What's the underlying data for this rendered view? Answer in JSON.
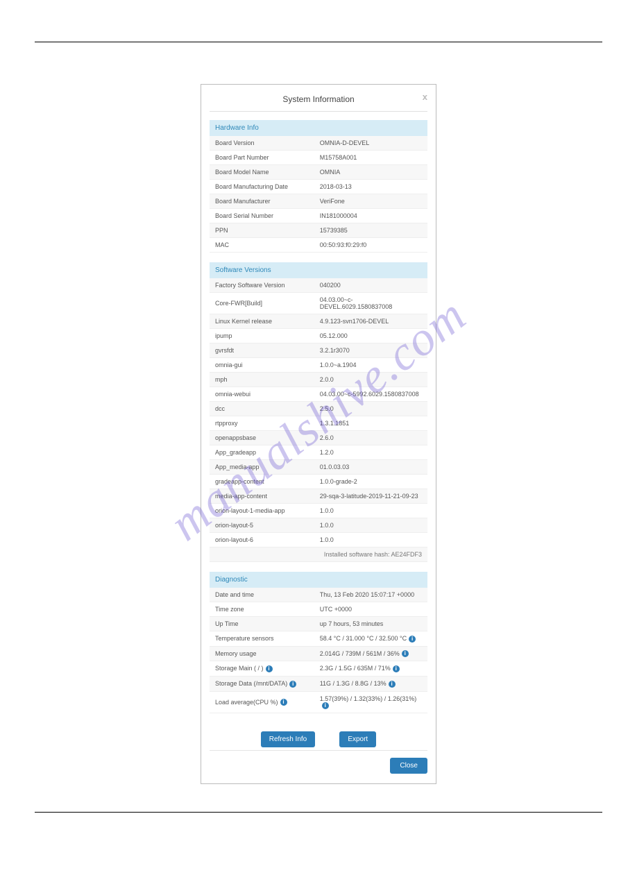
{
  "watermark": "manualshive.com",
  "dialog": {
    "title": "System Information",
    "close_x": "x"
  },
  "hardware": {
    "header": "Hardware Info",
    "rows": [
      {
        "label": "Board Version",
        "value": "OMNIA-D-DEVEL"
      },
      {
        "label": "Board Part Number",
        "value": "M15758A001"
      },
      {
        "label": "Board Model Name",
        "value": "OMNIA"
      },
      {
        "label": "Board Manufacturing Date",
        "value": "2018-03-13"
      },
      {
        "label": "Board Manufacturer",
        "value": "VeriFone"
      },
      {
        "label": "Board Serial Number",
        "value": "IN181000004"
      },
      {
        "label": "PPN",
        "value": "15739385"
      },
      {
        "label": "MAC",
        "value": "00:50:93:f0:29:f0"
      }
    ]
  },
  "software": {
    "header": "Software Versions",
    "rows": [
      {
        "label": "Factory Software Version",
        "value": "040200"
      },
      {
        "label": "Core-FWR[Build]",
        "value": "04.03.00~c-DEVEL.6029.1580837008"
      },
      {
        "label": "Linux Kernel release",
        "value": "4.9.123-svn1706-DEVEL"
      },
      {
        "label": "ipump",
        "value": "05.12.000"
      },
      {
        "label": "gvrsfdt",
        "value": "3.2.1r3070"
      },
      {
        "label": "omnia-gui",
        "value": "1.0.0~a.1904"
      },
      {
        "label": "mph",
        "value": "2.0.0"
      },
      {
        "label": "omnia-webui",
        "value": "04.03.00~c-5992.6029.1580837008"
      },
      {
        "label": "dcc",
        "value": "2.5.0"
      },
      {
        "label": "rtpproxy",
        "value": "1.3.1.1851"
      },
      {
        "label": "openappsbase",
        "value": "2.6.0"
      },
      {
        "label": "App_gradeapp",
        "value": "1.2.0"
      },
      {
        "label": "App_media-app",
        "value": "01.0.03.03"
      },
      {
        "label": "gradeapp-content",
        "value": "1.0.0-grade-2"
      },
      {
        "label": "media-app-content",
        "value": "29-sqa-3-latitude-2019-11-21-09-23"
      },
      {
        "label": "orion-layout-1-media-app",
        "value": "1.0.0"
      },
      {
        "label": "orion-layout-5",
        "value": "1.0.0"
      },
      {
        "label": "orion-layout-6",
        "value": "1.0.0"
      }
    ],
    "hash": "Installed software hash: AE24FDF3"
  },
  "diagnostic": {
    "header": "Diagnostic",
    "rows": [
      {
        "label": "Date and time",
        "value": "Thu, 13 Feb 2020 15:07:17 +0000",
        "info_label": false,
        "info_value": false
      },
      {
        "label": "Time zone",
        "value": "UTC +0000",
        "info_label": false,
        "info_value": false
      },
      {
        "label": "Up Time",
        "value": "up 7 hours, 53 minutes",
        "info_label": false,
        "info_value": false
      },
      {
        "label": "Temperature sensors",
        "value": "58.4 °C / 31.000 °C / 32.500 °C",
        "info_label": false,
        "info_value": true
      },
      {
        "label": "Memory usage",
        "value": "2.014G / 739M / 561M / 36%",
        "info_label": false,
        "info_value": true
      },
      {
        "label": "Storage Main ( / )",
        "value": "2.3G / 1.5G / 635M / 71%",
        "info_label": true,
        "info_value": true
      },
      {
        "label": "Storage Data (/mnt/DATA)",
        "value": "11G / 1.3G / 8.8G / 13%",
        "info_label": true,
        "info_value": true
      },
      {
        "label": "Load average(CPU %)",
        "value": "1.57(39%) / 1.32(33%) / 1.26(31%)",
        "info_label": true,
        "info_value": true
      }
    ]
  },
  "buttons": {
    "refresh": "Refresh Info",
    "export": "Export",
    "close": "Close"
  }
}
